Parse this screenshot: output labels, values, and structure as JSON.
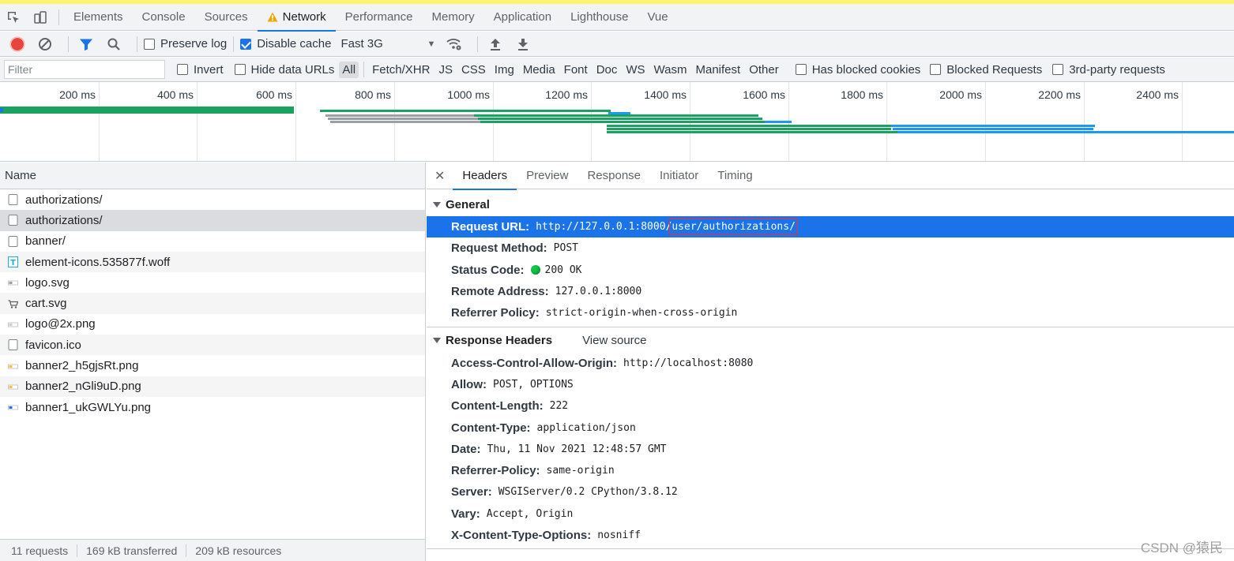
{
  "tabs": {
    "items": [
      {
        "label": "Elements"
      },
      {
        "label": "Console"
      },
      {
        "label": "Sources"
      },
      {
        "label": "Network",
        "active": true,
        "warning": true
      },
      {
        "label": "Performance"
      },
      {
        "label": "Memory"
      },
      {
        "label": "Application"
      },
      {
        "label": "Lighthouse"
      },
      {
        "label": "Vue"
      }
    ]
  },
  "toolbar": {
    "preserve_log": "Preserve log",
    "disable_cache": "Disable cache",
    "throttle": "Fast 3G"
  },
  "filter": {
    "placeholder": "Filter",
    "invert": "Invert",
    "hide_data_urls": "Hide data URLs",
    "types": [
      "All",
      "Fetch/XHR",
      "JS",
      "CSS",
      "Img",
      "Media",
      "Font",
      "Doc",
      "WS",
      "Wasm",
      "Manifest",
      "Other"
    ],
    "has_blocked_cookies": "Has blocked cookies",
    "blocked_requests": "Blocked Requests",
    "third_party": "3rd-party requests"
  },
  "overview": {
    "ticks": [
      "200 ms",
      "400 ms",
      "600 ms",
      "800 ms",
      "1000 ms",
      "1200 ms",
      "1400 ms",
      "1600 ms",
      "1800 ms",
      "2000 ms",
      "2200 ms",
      "2400 ms"
    ]
  },
  "requests": {
    "header": "Name",
    "items": [
      {
        "name": "authorizations/",
        "icon": "doc-icon"
      },
      {
        "name": "authorizations/",
        "icon": "doc-icon"
      },
      {
        "name": "banner/",
        "icon": "doc-icon"
      },
      {
        "name": "element-icons.535877f.woff",
        "icon": "font-icon"
      },
      {
        "name": "logo.svg",
        "icon": "image-icon"
      },
      {
        "name": "cart.svg",
        "icon": "cart-icon"
      },
      {
        "name": "logo@2x.png",
        "icon": "image-icon"
      },
      {
        "name": "favicon.ico",
        "icon": "doc-icon"
      },
      {
        "name": "banner2_h5gjsRt.png",
        "icon": "image-icon"
      },
      {
        "name": "banner2_nGli9uD.png",
        "icon": "image-icon"
      },
      {
        "name": "banner1_ukGWLYu.png",
        "icon": "image-icon"
      }
    ]
  },
  "status": {
    "requests": "11 requests",
    "transferred": "169 kB transferred",
    "resources": "209 kB resources"
  },
  "details": {
    "tabs": [
      "Headers",
      "Preview",
      "Response",
      "Initiator",
      "Timing"
    ],
    "general": {
      "title": "General",
      "request_url_key": "Request URL:",
      "request_url_base": "http://127.0.0.1:8000/",
      "request_url_path": "user/authorizations/",
      "request_method_key": "Request Method:",
      "request_method": "POST",
      "status_code_key": "Status Code:",
      "status_code": "200 OK",
      "remote_address_key": "Remote Address:",
      "remote_address": "127.0.0.1:8000",
      "referrer_policy_key": "Referrer Policy:",
      "referrer_policy": "strict-origin-when-cross-origin"
    },
    "response_headers": {
      "title": "Response Headers",
      "view_source": "View source",
      "items": [
        {
          "key": "Access-Control-Allow-Origin:",
          "value": "http://localhost:8080"
        },
        {
          "key": "Allow:",
          "value": "POST, OPTIONS"
        },
        {
          "key": "Content-Length:",
          "value": "222"
        },
        {
          "key": "Content-Type:",
          "value": "application/json"
        },
        {
          "key": "Date:",
          "value": "Thu, 11 Nov 2021 12:48:57 GMT"
        },
        {
          "key": "Referrer-Policy:",
          "value": "same-origin"
        },
        {
          "key": "Server:",
          "value": "WSGIServer/0.2 CPython/3.8.12"
        },
        {
          "key": "Vary:",
          "value": "Accept, Origin"
        },
        {
          "key": "X-Content-Type-Options:",
          "value": "nosniff"
        }
      ]
    }
  },
  "watermark": "CSDN @猿民",
  "colors": {
    "accent": "#1a73e8",
    "record": "#e8453c",
    "status_ok": "#0ec74a",
    "waterfall_green": "#1aa260",
    "waterfall_blue": "#1a9af0"
  }
}
